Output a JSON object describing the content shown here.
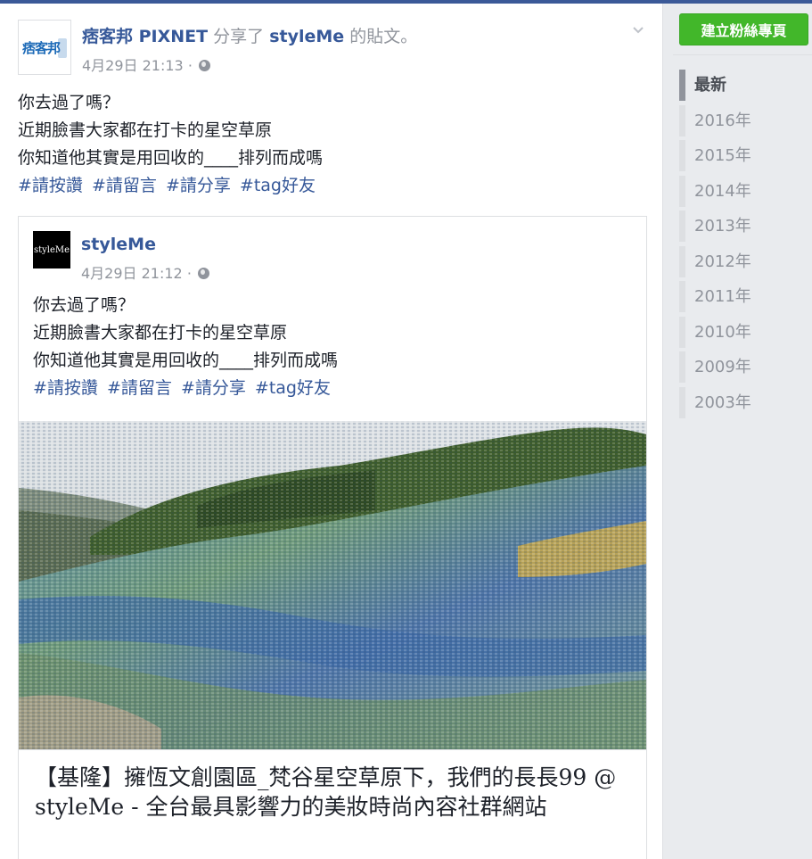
{
  "shared_post": {
    "page_name": "痞客邦 PIXNET",
    "action_text": "分享了",
    "shared_from": "styleMe",
    "post_suffix": "的貼文。",
    "avatar_text": "痞客邦",
    "timestamp": "4月29日 21:13 ·",
    "lines": [
      "你去過了嗎？",
      "近期臉書大家都在打卡的星空草原",
      "你知道他其實是用回收的____排列而成嗎"
    ],
    "hashtags": [
      "#請按讚",
      "#請留言",
      "#請分享",
      "#tag好友"
    ]
  },
  "original_post": {
    "author": "styleMe",
    "avatar_text": "styleMe",
    "timestamp": "4月29日 21:12 ·",
    "lines": [
      "你去過了嗎？",
      "近期臉書大家都在打卡的星空草原",
      "你知道他其實是用回收的____排列而成嗎"
    ],
    "hashtags": [
      "#請按讚",
      "#請留言",
      "#請分享",
      "#tag好友"
    ],
    "link_title": "【基隆】擁恆文創園區_梵谷星空草原下，我們的長長99 @ styleMe - 全台最具影響力的美妝時尚內容社群網站"
  },
  "sidebar": {
    "create_page_button": "建立粉絲專頁",
    "years": [
      "最新",
      "2016年",
      "2015年",
      "2014年",
      "2013年",
      "2012年",
      "2011年",
      "2010年",
      "2009年",
      "2003年"
    ],
    "active_index": 0
  },
  "colors": {
    "link": "#365899",
    "meta": "#90949c",
    "button_green": "#42b72a",
    "top_bar": "#3b5998"
  },
  "icons": [
    "globe-icon",
    "chevron-down-icon"
  ]
}
